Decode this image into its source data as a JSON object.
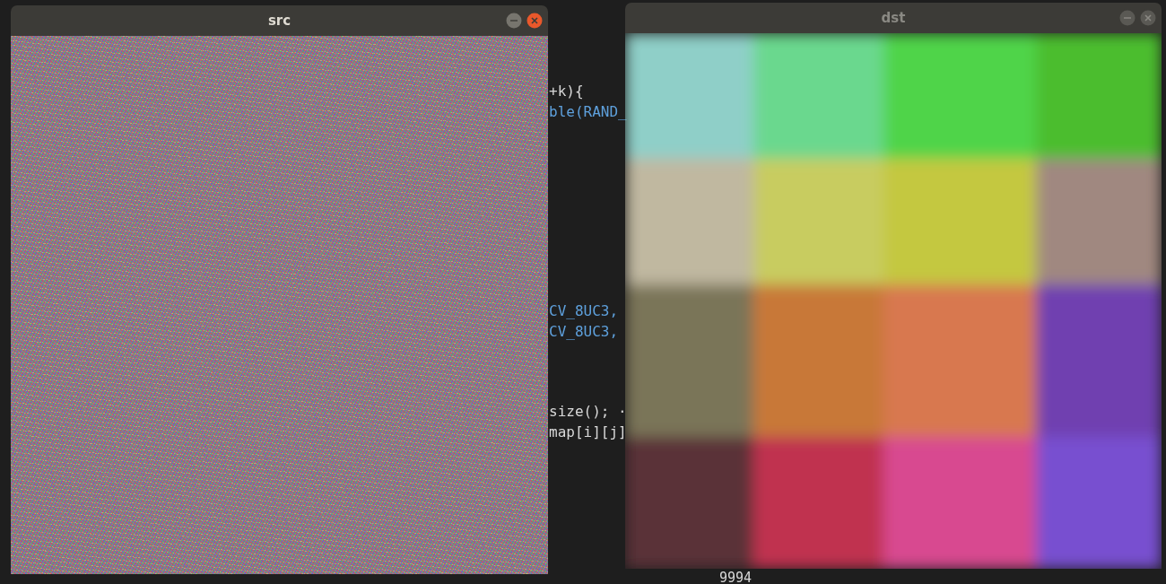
{
  "editor": {
    "lines": [
      "+k){",
      "ble(RAND_",
      "CV_8UC3,",
      "CV_8UC3,",
      "size(); ·",
      "map[i][j]"
    ],
    "output": "9994"
  },
  "windows": [
    {
      "title": "src",
      "focused": true,
      "kind": "noise"
    },
    {
      "title": "dst",
      "focused": false,
      "kind": "blocks"
    }
  ]
}
